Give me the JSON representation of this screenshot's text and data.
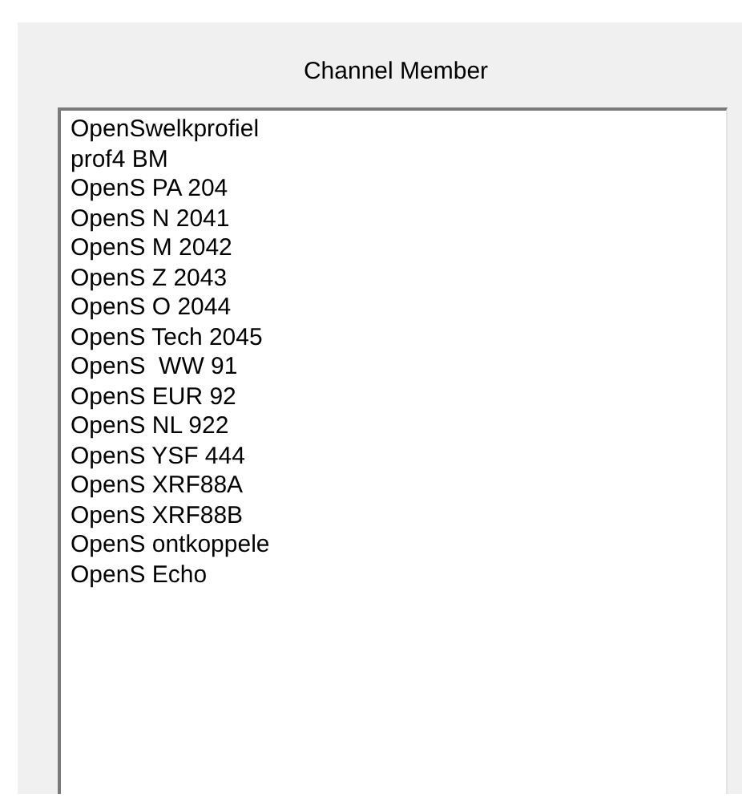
{
  "group": {
    "title": "Channel Member"
  },
  "list": {
    "items": [
      {
        "label": "OpenSwelkprofiel"
      },
      {
        "label": "prof4 BM"
      },
      {
        "label": "OpenS PA 204"
      },
      {
        "label": "OpenS N 2041"
      },
      {
        "label": "OpenS M 2042"
      },
      {
        "label": "OpenS Z 2043"
      },
      {
        "label": "OpenS O 2044"
      },
      {
        "label": "OpenS Tech 2045"
      },
      {
        "label": "OpenS  WW 91"
      },
      {
        "label": "OpenS EUR 92"
      },
      {
        "label": "OpenS NL 922"
      },
      {
        "label": "OpenS YSF 444"
      },
      {
        "label": "OpenS XRF88A"
      },
      {
        "label": "OpenS XRF88B"
      },
      {
        "label": "OpenS ontkoppele"
      },
      {
        "label": "OpenS Echo"
      }
    ]
  }
}
